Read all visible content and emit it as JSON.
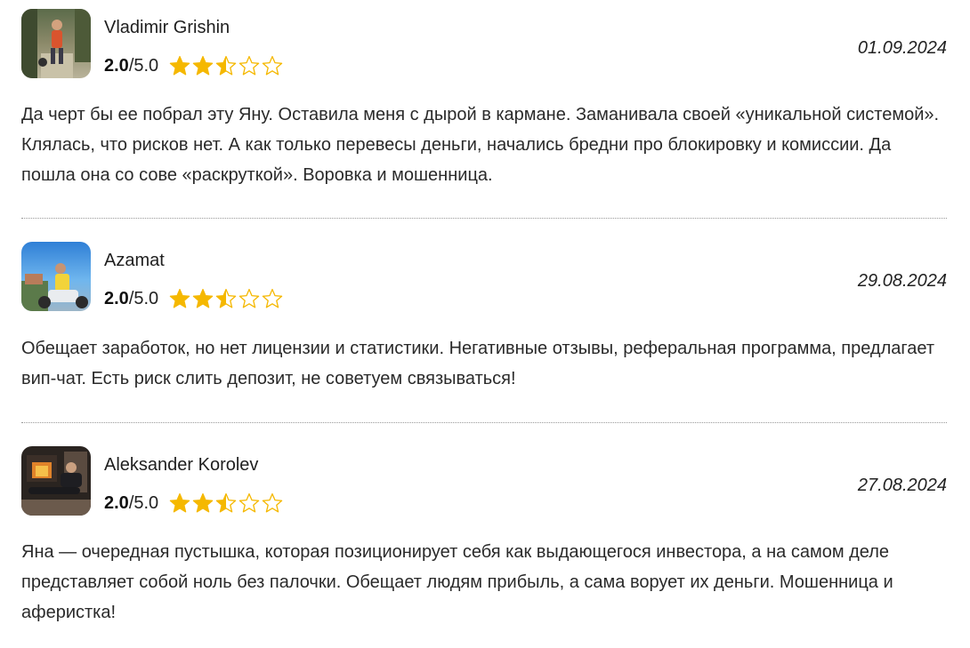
{
  "reviews": [
    {
      "name": "Vladimir Grishin",
      "rating_value": "2.0",
      "rating_max": "/5.0",
      "stars": 2.5,
      "date": "01.09.2024",
      "text": "Да черт бы ее побрал эту Яну. Оставила меня с дырой в кармане. Заманивала своей «уникальной системой». Клялась, что рисков нет. А как только перевесы деньги, начались бредни про блокировку и комиссии. Да пошла она со сове «раскруткой». Воровка и мошенница."
    },
    {
      "name": "Azamat",
      "rating_value": "2.0",
      "rating_max": "/5.0",
      "stars": 2.5,
      "date": "29.08.2024",
      "text": "Обещает заработок, но нет лицензии и статистики. Негативные отзывы, реферальная программа, предлагает вип-чат. Есть риск слить депозит, не советуем связываться!"
    },
    {
      "name": "Aleksander Korolev",
      "rating_value": "2.0",
      "rating_max": "/5.0",
      "stars": 2.5,
      "date": "27.08.2024",
      "text": "Яна — очередная пустышка, которая позиционирует себя как выдающегося инвестора, а на самом деле представляет собой ноль без палочки. Обещает людям прибыль, а сама ворует их деньги. Мошенница и аферистка!"
    }
  ],
  "colors": {
    "star_fill": "#F5B800",
    "star_outline": "#F5B800",
    "divider": "#999999"
  },
  "icons": {
    "star_full": "star-full-icon",
    "star_half": "star-half-icon",
    "star_empty": "star-empty-icon"
  }
}
